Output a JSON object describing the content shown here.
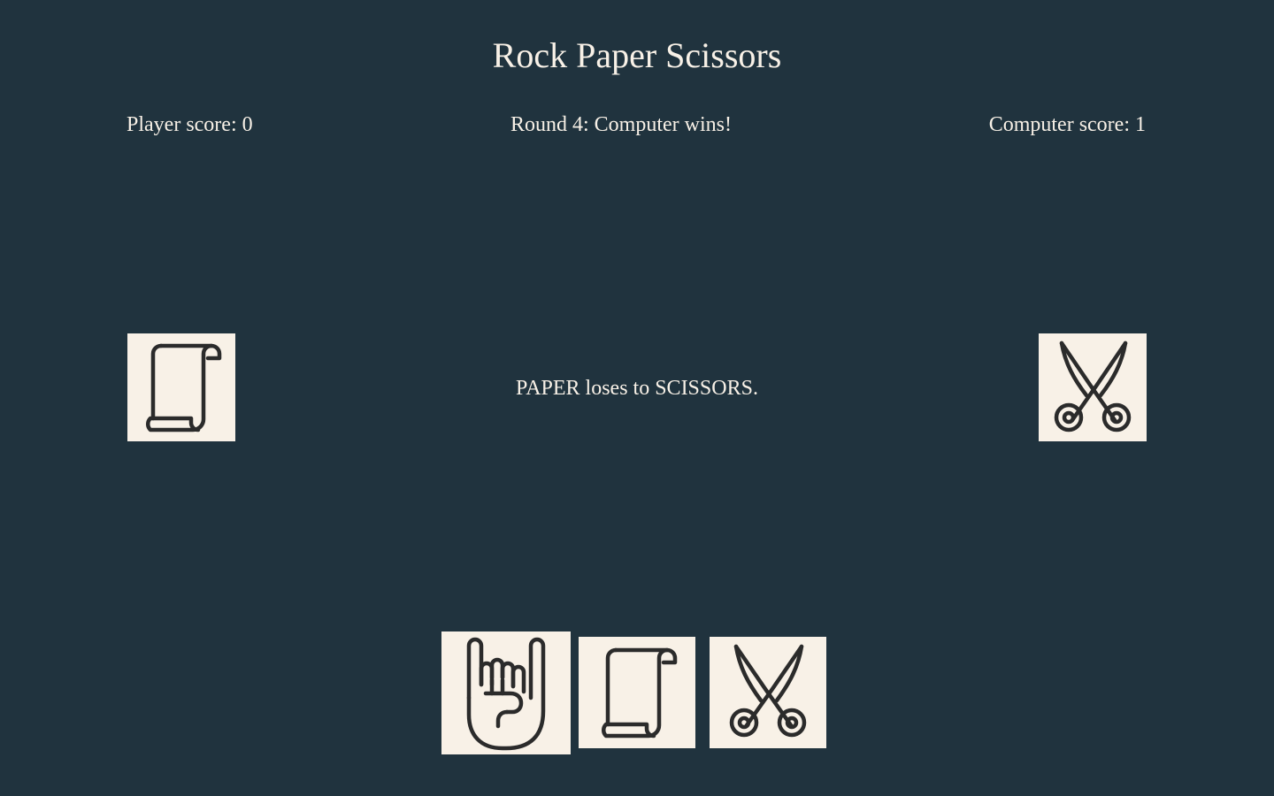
{
  "game": {
    "title": "Rock Paper Scissors",
    "player_score_text": "Player score: 0",
    "round_status_text": "Round 4: Computer wins!",
    "computer_score_text": "Computer score: 1",
    "result_text": "PAPER loses to SCISSORS.",
    "player_choice": "paper",
    "computer_choice": "scissors"
  },
  "options": [
    {
      "name": "rock",
      "icon": "rock-hand-icon"
    },
    {
      "name": "paper",
      "icon": "paper-scroll-icon"
    },
    {
      "name": "scissors",
      "icon": "scissors-icon"
    }
  ],
  "colors": {
    "background": "#20333e",
    "text": "#f8f1e7",
    "tile": "#f8f1e7",
    "icon_stroke": "#2b2b2b"
  }
}
